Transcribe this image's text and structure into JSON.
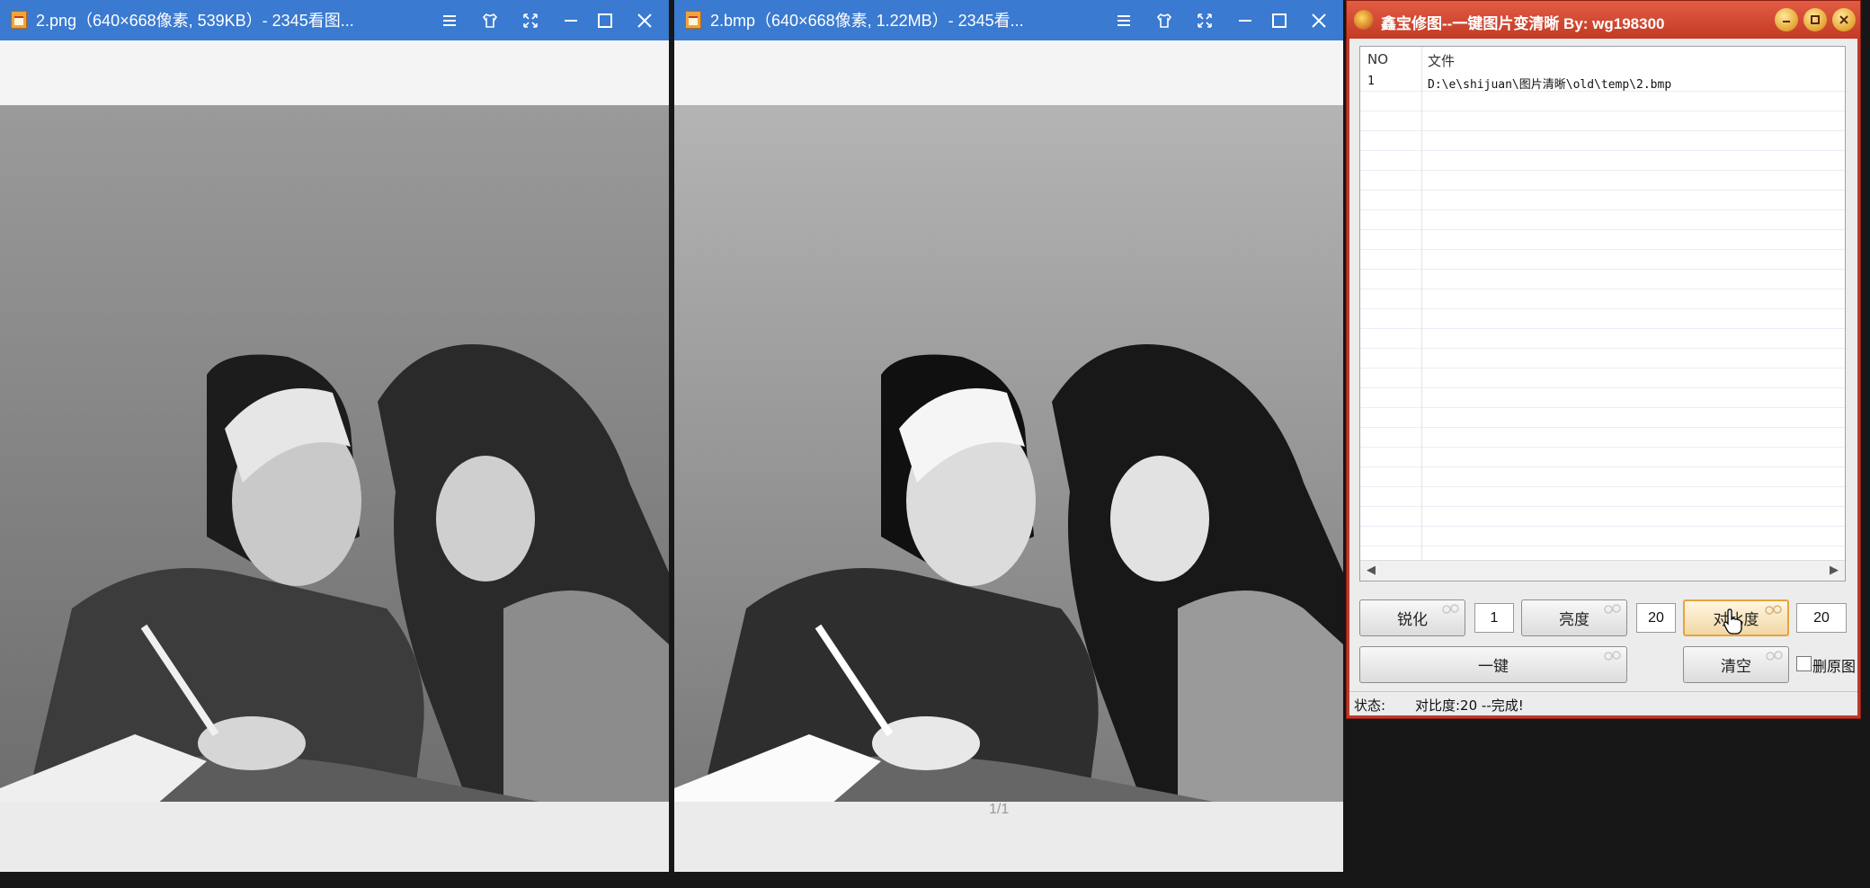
{
  "viewer1": {
    "title": "2.png（640×668像素, 539KB）- 2345看图..."
  },
  "viewer2": {
    "title": "2.bmp（640×668像素, 1.22MB）- 2345看...",
    "page_indicator": "1/1"
  },
  "tool": {
    "title": "鑫宝修图--一键图片变清晰 By:  wg198300",
    "list": {
      "columns": [
        "NO",
        "文件"
      ],
      "rows": [
        {
          "no": "1",
          "file": "D:\\e\\shijuan\\图片清晰\\old\\temp\\2.bmp"
        }
      ]
    },
    "buttons": {
      "sharpen": "锐化",
      "brightness": "亮度",
      "contrast": "对比度",
      "one_click": "一键",
      "clear": "清空"
    },
    "values": {
      "sharpen": "1",
      "brightness": "20",
      "contrast": "20"
    },
    "delete_original_label": "删原图",
    "status_label": "状态:",
    "status_text": "对比度:20 --完成!"
  },
  "icons": [
    "image-viewer-app-icon",
    "menu-icon",
    "skin-icon",
    "fullscreen-icon",
    "maximize-icon",
    "close-icon",
    "xinbao-app-icon",
    "minimize-icon",
    "cursor-pointer-icon"
  ]
}
